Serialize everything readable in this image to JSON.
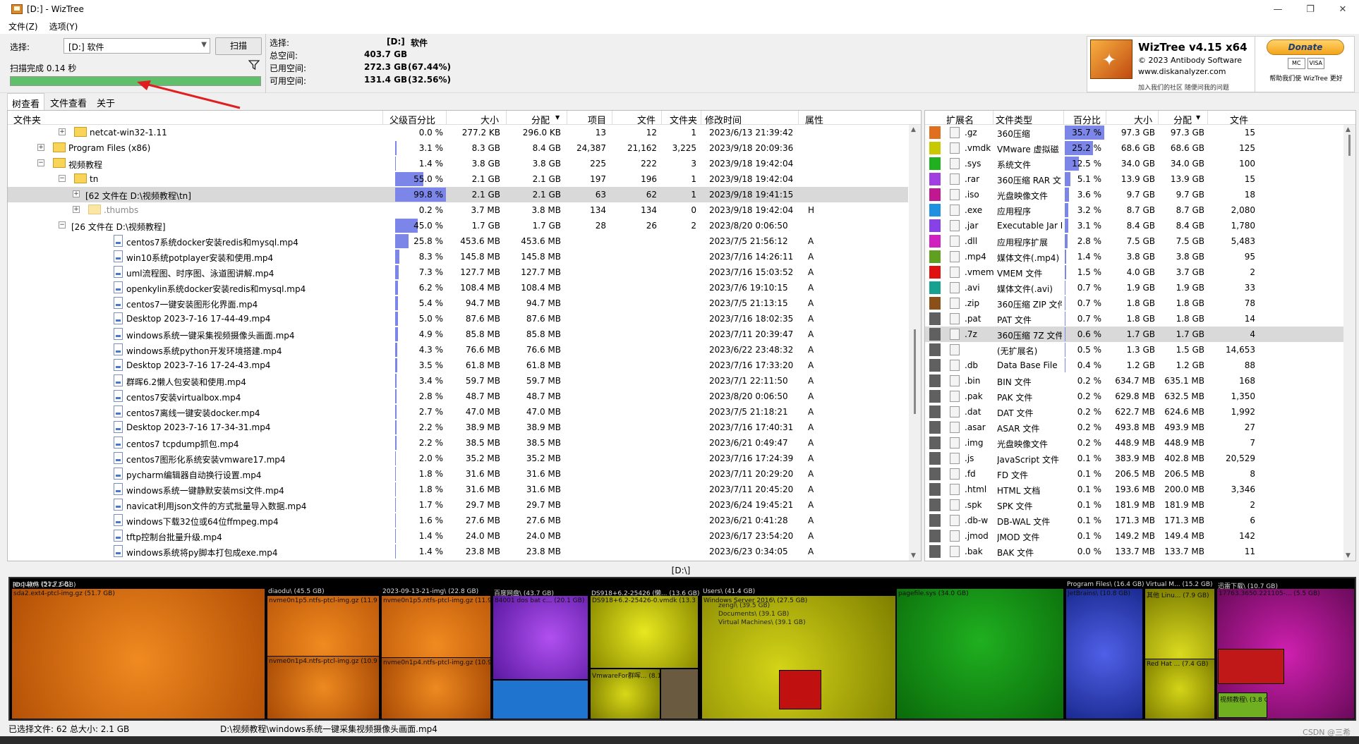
{
  "window": {
    "title": "[D:]  - WizTree"
  },
  "menu": {
    "file": "文件(Z)",
    "options": "选项(Y)"
  },
  "select": {
    "label": "选择:",
    "value": "[D:] 软件",
    "scan_button": "扫描",
    "scan_done": "扫描完成 0.14 秒",
    "progress": 1.0
  },
  "stats": {
    "select_label": "选择:",
    "drive": "[D:]",
    "drive_name": "软件",
    "total_label": "总空间:",
    "total": "403.7 GB",
    "used_label": "已用空间:",
    "used": "272.3 GB",
    "used_pct": "(67.44%)",
    "free_label": "可用空间:",
    "free": "131.4 GB",
    "free_pct": "(32.56%)"
  },
  "brand": {
    "name": "WizTree v4.15 x64",
    "copyright": "© 2023 Antibody Software",
    "url": "www.diskanalyzer.com",
    "sub": "加入我们的社区 随便问我的问题"
  },
  "donate": {
    "label": "Donate",
    "card1": "MC",
    "card2": "VISA",
    "thanks": "帮助我们使 WizTree 更好"
  },
  "tabs": [
    "树查看",
    "文件查看",
    "关于"
  ],
  "tree": {
    "headers": [
      "文件夹",
      "父级百分比",
      "大小",
      "分配",
      "项目",
      "文件",
      "文件夹",
      "修改时间",
      "属性"
    ],
    "rows": [
      {
        "name": "netcat-win32-1.11",
        "indent": 2,
        "type": "folder",
        "exp": "+",
        "pct": "0.0 %",
        "pctv": 0.0,
        "size": "277.2 KB",
        "alloc": "296.0 KB",
        "items": "13",
        "files": "12",
        "folders": "1",
        "mtime": "2023/6/13 21:39:42",
        "attr": ""
      },
      {
        "name": "Program Files (x86)",
        "indent": 1,
        "type": "folder",
        "exp": "+",
        "pct": "3.1 %",
        "pctv": 0.031,
        "size": "8.3 GB",
        "alloc": "8.4 GB",
        "items": "24,387",
        "files": "21,162",
        "folders": "3,225",
        "mtime": "2023/9/18 20:09:36",
        "attr": ""
      },
      {
        "name": "视频教程",
        "indent": 1,
        "type": "folder",
        "exp": "−",
        "pct": "1.4 %",
        "pctv": 0.014,
        "size": "3.8 GB",
        "alloc": "3.8 GB",
        "items": "225",
        "files": "222",
        "folders": "3",
        "mtime": "2023/9/18 19:42:04",
        "attr": ""
      },
      {
        "name": "tn",
        "indent": 2,
        "type": "folder",
        "exp": "−",
        "pct": "55.0 %",
        "pctv": 0.55,
        "size": "2.1 GB",
        "alloc": "2.1 GB",
        "items": "197",
        "files": "196",
        "folders": "1",
        "mtime": "2023/9/18 19:42:04",
        "attr": ""
      },
      {
        "name": "[62 文件在 D:\\视频教程\\tn]",
        "indent": 3,
        "type": "none",
        "exp": "+",
        "pct": "99.8 %",
        "pctv": 0.998,
        "size": "2.1 GB",
        "alloc": "2.1 GB",
        "items": "63",
        "files": "62",
        "folders": "1",
        "mtime": "2023/9/18 19:41:15",
        "attr": "",
        "hl": true
      },
      {
        "name": ".thumbs",
        "indent": 3,
        "type": "folder",
        "exp": "+",
        "pct": "0.2 %",
        "pctv": 0.002,
        "size": "3.7 MB",
        "alloc": "3.8 MB",
        "items": "134",
        "files": "134",
        "folders": "0",
        "mtime": "2023/9/18 19:42:04",
        "attr": "H",
        "dim": true
      },
      {
        "name": "[26 文件在 D:\\视频教程]",
        "indent": 2,
        "type": "none",
        "exp": "−",
        "pct": "45.0 %",
        "pctv": 0.45,
        "size": "1.7 GB",
        "alloc": "1.7 GB",
        "items": "28",
        "files": "26",
        "folders": "2",
        "mtime": "2023/8/20 0:06:50",
        "attr": ""
      },
      {
        "name": "centos7系统docker安装redis和mysql.mp4",
        "indent": 4,
        "type": "file",
        "pct": "25.8 %",
        "pctv": 0.258,
        "size": "453.6 MB",
        "alloc": "453.6 MB",
        "items": "",
        "files": "",
        "folders": "",
        "mtime": "2023/7/5 21:56:12",
        "attr": "A"
      },
      {
        "name": "win10系统potplayer安装和使用.mp4",
        "indent": 4,
        "type": "file",
        "pct": "8.3 %",
        "pctv": 0.083,
        "size": "145.8 MB",
        "alloc": "145.8 MB",
        "items": "",
        "files": "",
        "folders": "",
        "mtime": "2023/7/16 14:26:11",
        "attr": "A"
      },
      {
        "name": "uml流程图、时序图、泳道图讲解.mp4",
        "indent": 4,
        "type": "file",
        "pct": "7.3 %",
        "pctv": 0.073,
        "size": "127.7 MB",
        "alloc": "127.7 MB",
        "items": "",
        "files": "",
        "folders": "",
        "mtime": "2023/7/16 15:03:52",
        "attr": "A"
      },
      {
        "name": "openkylin系统docker安装redis和mysql.mp4",
        "indent": 4,
        "type": "file",
        "pct": "6.2 %",
        "pctv": 0.062,
        "size": "108.4 MB",
        "alloc": "108.4 MB",
        "items": "",
        "files": "",
        "folders": "",
        "mtime": "2023/7/6 19:10:15",
        "attr": "A"
      },
      {
        "name": "centos7一键安装图形化界面.mp4",
        "indent": 4,
        "type": "file",
        "pct": "5.4 %",
        "pctv": 0.054,
        "size": "94.7 MB",
        "alloc": "94.7 MB",
        "items": "",
        "files": "",
        "folders": "",
        "mtime": "2023/7/5 21:13:15",
        "attr": "A"
      },
      {
        "name": "Desktop 2023-7-16 17-44-49.mp4",
        "indent": 4,
        "type": "file",
        "pct": "5.0 %",
        "pctv": 0.05,
        "size": "87.6 MB",
        "alloc": "87.6 MB",
        "items": "",
        "files": "",
        "folders": "",
        "mtime": "2023/7/16 18:02:35",
        "attr": "A"
      },
      {
        "name": "windows系统一键采集视频摄像头画面.mp4",
        "indent": 4,
        "type": "file",
        "pct": "4.9 %",
        "pctv": 0.049,
        "size": "85.8 MB",
        "alloc": "85.8 MB",
        "items": "",
        "files": "",
        "folders": "",
        "mtime": "2023/7/11 20:39:47",
        "attr": "A"
      },
      {
        "name": "windows系统python开发环境搭建.mp4",
        "indent": 4,
        "type": "file",
        "pct": "4.3 %",
        "pctv": 0.043,
        "size": "76.6 MB",
        "alloc": "76.6 MB",
        "items": "",
        "files": "",
        "folders": "",
        "mtime": "2023/6/22 23:48:32",
        "attr": "A"
      },
      {
        "name": "Desktop 2023-7-16 17-24-43.mp4",
        "indent": 4,
        "type": "file",
        "pct": "3.5 %",
        "pctv": 0.035,
        "size": "61.8 MB",
        "alloc": "61.8 MB",
        "items": "",
        "files": "",
        "folders": "",
        "mtime": "2023/7/16 17:33:20",
        "attr": "A"
      },
      {
        "name": "群晖6.2懒人包安装和使用.mp4",
        "indent": 4,
        "type": "file",
        "pct": "3.4 %",
        "pctv": 0.034,
        "size": "59.7 MB",
        "alloc": "59.7 MB",
        "items": "",
        "files": "",
        "folders": "",
        "mtime": "2023/7/1 22:11:50",
        "attr": "A"
      },
      {
        "name": "centos7安装virtualbox.mp4",
        "indent": 4,
        "type": "file",
        "pct": "2.8 %",
        "pctv": 0.028,
        "size": "48.7 MB",
        "alloc": "48.7 MB",
        "items": "",
        "files": "",
        "folders": "",
        "mtime": "2023/8/20 0:06:50",
        "attr": "A"
      },
      {
        "name": "centos7离线一键安装docker.mp4",
        "indent": 4,
        "type": "file",
        "pct": "2.7 %",
        "pctv": 0.027,
        "size": "47.0 MB",
        "alloc": "47.0 MB",
        "items": "",
        "files": "",
        "folders": "",
        "mtime": "2023/7/5 21:18:21",
        "attr": "A"
      },
      {
        "name": "Desktop 2023-7-16 17-34-31.mp4",
        "indent": 4,
        "type": "file",
        "pct": "2.2 %",
        "pctv": 0.022,
        "size": "38.9 MB",
        "alloc": "38.9 MB",
        "items": "",
        "files": "",
        "folders": "",
        "mtime": "2023/7/16 17:40:31",
        "attr": "A"
      },
      {
        "name": "centos7 tcpdump抓包.mp4",
        "indent": 4,
        "type": "file",
        "pct": "2.2 %",
        "pctv": 0.022,
        "size": "38.5 MB",
        "alloc": "38.5 MB",
        "items": "",
        "files": "",
        "folders": "",
        "mtime": "2023/6/21 0:49:47",
        "attr": "A"
      },
      {
        "name": "centos7图形化系统安装vmware17.mp4",
        "indent": 4,
        "type": "file",
        "pct": "2.0 %",
        "pctv": 0.02,
        "size": "35.2 MB",
        "alloc": "35.2 MB",
        "items": "",
        "files": "",
        "folders": "",
        "mtime": "2023/7/16 17:24:39",
        "attr": "A"
      },
      {
        "name": "pycharm编辑器自动换行设置.mp4",
        "indent": 4,
        "type": "file",
        "pct": "1.8 %",
        "pctv": 0.018,
        "size": "31.6 MB",
        "alloc": "31.6 MB",
        "items": "",
        "files": "",
        "folders": "",
        "mtime": "2023/7/11 20:29:20",
        "attr": "A"
      },
      {
        "name": "windows系统一键静默安装msi文件.mp4",
        "indent": 4,
        "type": "file",
        "pct": "1.8 %",
        "pctv": 0.018,
        "size": "31.6 MB",
        "alloc": "31.6 MB",
        "items": "",
        "files": "",
        "folders": "",
        "mtime": "2023/7/11 20:45:20",
        "attr": "A"
      },
      {
        "name": "navicat利用json文件的方式批量导入数据.mp4",
        "indent": 4,
        "type": "file",
        "pct": "1.7 %",
        "pctv": 0.017,
        "size": "29.7 MB",
        "alloc": "29.7 MB",
        "items": "",
        "files": "",
        "folders": "",
        "mtime": "2023/6/24 19:45:21",
        "attr": "A"
      },
      {
        "name": "windows下载32位或64位ffmpeg.mp4",
        "indent": 4,
        "type": "file",
        "pct": "1.6 %",
        "pctv": 0.016,
        "size": "27.6 MB",
        "alloc": "27.6 MB",
        "items": "",
        "files": "",
        "folders": "",
        "mtime": "2023/6/21 0:41:28",
        "attr": "A"
      },
      {
        "name": "tftp控制台批量升级.mp4",
        "indent": 4,
        "type": "file",
        "pct": "1.4 %",
        "pctv": 0.014,
        "size": "24.0 MB",
        "alloc": "24.0 MB",
        "items": "",
        "files": "",
        "folders": "",
        "mtime": "2023/6/17 23:54:20",
        "attr": "A"
      },
      {
        "name": "windows系统将py脚本打包成exe.mp4",
        "indent": 4,
        "type": "file",
        "pct": "1.4 %",
        "pctv": 0.014,
        "size": "23.8 MB",
        "alloc": "23.8 MB",
        "items": "",
        "files": "",
        "folders": "",
        "mtime": "2023/6/23 0:34:05",
        "attr": "A"
      }
    ]
  },
  "ext": {
    "headers": [
      "扩展名",
      "文件类型",
      "百分比",
      "大小",
      "分配",
      "文件"
    ],
    "rows": [
      {
        "color": "#e07020",
        "ext": ".gz",
        "type": "360压缩",
        "pct": "35.7 %",
        "pctv": 0.357,
        "size": "97.3 GB",
        "alloc": "97.3 GB",
        "files": "15"
      },
      {
        "color": "#c8c800",
        "ext": ".vmdk",
        "type": "VMware 虚拟磁",
        "pct": "25.2 %",
        "pctv": 0.252,
        "size": "68.6 GB",
        "alloc": "68.6 GB",
        "files": "125"
      },
      {
        "color": "#20b020",
        "ext": ".sys",
        "type": "系统文件",
        "pct": "12.5 %",
        "pctv": 0.125,
        "size": "34.0 GB",
        "alloc": "34.0 GB",
        "files": "100"
      },
      {
        "color": "#a040e0",
        "ext": ".rar",
        "type": "360压缩 RAR 文",
        "pct": "5.1 %",
        "pctv": 0.051,
        "size": "13.9 GB",
        "alloc": "13.9 GB",
        "files": "15"
      },
      {
        "color": "#c01890",
        "ext": ".iso",
        "type": "光盘映像文件",
        "pct": "3.6 %",
        "pctv": 0.036,
        "size": "9.7 GB",
        "alloc": "9.7 GB",
        "files": "18"
      },
      {
        "color": "#2090e0",
        "ext": ".exe",
        "type": "应用程序",
        "pct": "3.2 %",
        "pctv": 0.032,
        "size": "8.7 GB",
        "alloc": "8.7 GB",
        "files": "2,080"
      },
      {
        "color": "#8840e8",
        "ext": ".jar",
        "type": "Executable Jar Fi",
        "pct": "3.1 %",
        "pctv": 0.031,
        "size": "8.4 GB",
        "alloc": "8.4 GB",
        "files": "1,780"
      },
      {
        "color": "#d020c0",
        "ext": ".dll",
        "type": "应用程序扩展",
        "pct": "2.8 %",
        "pctv": 0.028,
        "size": "7.5 GB",
        "alloc": "7.5 GB",
        "files": "5,483"
      },
      {
        "color": "#60a020",
        "ext": ".mp4",
        "type": "媒体文件(.mp4)",
        "pct": "1.4 %",
        "pctv": 0.014,
        "size": "3.8 GB",
        "alloc": "3.8 GB",
        "files": "95"
      },
      {
        "color": "#e01010",
        "ext": ".vmem",
        "type": "VMEM 文件",
        "pct": "1.5 %",
        "pctv": 0.015,
        "size": "4.0 GB",
        "alloc": "3.7 GB",
        "files": "2"
      },
      {
        "color": "#18a090",
        "ext": ".avi",
        "type": "媒体文件(.avi)",
        "pct": "0.7 %",
        "pctv": 0.007,
        "size": "1.9 GB",
        "alloc": "1.9 GB",
        "files": "33"
      },
      {
        "color": "#8a5018",
        "ext": ".zip",
        "type": "360压缩 ZIP 文件",
        "pct": "0.7 %",
        "pctv": 0.007,
        "size": "1.8 GB",
        "alloc": "1.8 GB",
        "files": "78"
      },
      {
        "color": "#606060",
        "ext": ".pat",
        "type": "PAT 文件",
        "pct": "0.7 %",
        "pctv": 0.007,
        "size": "1.8 GB",
        "alloc": "1.8 GB",
        "files": "14"
      },
      {
        "color": "#606060",
        "ext": ".7z",
        "type": "360压缩 7Z 文件",
        "pct": "0.6 %",
        "pctv": 0.006,
        "size": "1.7 GB",
        "alloc": "1.7 GB",
        "files": "4",
        "hl": true
      },
      {
        "color": "#606060",
        "ext": "",
        "type": "(无扩展名)",
        "pct": "0.5 %",
        "pctv": 0.005,
        "size": "1.3 GB",
        "alloc": "1.5 GB",
        "files": "14,653"
      },
      {
        "color": "#606060",
        "ext": ".db",
        "type": "Data Base File",
        "pct": "0.4 %",
        "pctv": 0.004,
        "size": "1.2 GB",
        "alloc": "1.2 GB",
        "files": "88"
      },
      {
        "color": "#606060",
        "ext": ".bin",
        "type": "BIN 文件",
        "pct": "0.2 %",
        "pctv": 0.002,
        "size": "634.7 MB",
        "alloc": "635.1 MB",
        "files": "168"
      },
      {
        "color": "#606060",
        "ext": ".pak",
        "type": "PAK 文件",
        "pct": "0.2 %",
        "pctv": 0.002,
        "size": "629.8 MB",
        "alloc": "632.5 MB",
        "files": "1,350"
      },
      {
        "color": "#606060",
        "ext": ".dat",
        "type": "DAT 文件",
        "pct": "0.2 %",
        "pctv": 0.002,
        "size": "622.7 MB",
        "alloc": "624.6 MB",
        "files": "1,992"
      },
      {
        "color": "#606060",
        "ext": ".asar",
        "type": "ASAR 文件",
        "pct": "0.2 %",
        "pctv": 0.002,
        "size": "493.8 MB",
        "alloc": "493.9 MB",
        "files": "27"
      },
      {
        "color": "#606060",
        "ext": ".img",
        "type": "光盘映像文件",
        "pct": "0.2 %",
        "pctv": 0.002,
        "size": "448.9 MB",
        "alloc": "448.9 MB",
        "files": "7"
      },
      {
        "color": "#606060",
        "ext": ".js",
        "type": "JavaScript 文件",
        "pct": "0.1 %",
        "pctv": 0.001,
        "size": "383.9 MB",
        "alloc": "402.8 MB",
        "files": "20,529"
      },
      {
        "color": "#606060",
        "ext": ".fd",
        "type": "FD 文件",
        "pct": "0.1 %",
        "pctv": 0.001,
        "size": "206.5 MB",
        "alloc": "206.5 MB",
        "files": "8"
      },
      {
        "color": "#606060",
        "ext": ".html",
        "type": "HTML 文档",
        "pct": "0.1 %",
        "pctv": 0.001,
        "size": "193.6 MB",
        "alloc": "200.0 MB",
        "files": "3,346"
      },
      {
        "color": "#606060",
        "ext": ".spk",
        "type": "SPK 文件",
        "pct": "0.1 %",
        "pctv": 0.001,
        "size": "181.9 MB",
        "alloc": "181.9 MB",
        "files": "2"
      },
      {
        "color": "#606060",
        "ext": ".db-w",
        "type": "DB-WAL 文件",
        "pct": "0.1 %",
        "pctv": 0.001,
        "size": "171.3 MB",
        "alloc": "171.3 MB",
        "files": "6"
      },
      {
        "color": "#606060",
        "ext": ".jmod",
        "type": "JMOD 文件",
        "pct": "0.1 %",
        "pctv": 0.001,
        "size": "149.2 MB",
        "alloc": "149.4 MB",
        "files": "142"
      },
      {
        "color": "#606060",
        "ext": ".bak",
        "type": "BAK 文件",
        "pct": "0.0 %",
        "pctv": 0.0,
        "size": "133.7 MB",
        "alloc": "133.7 MB",
        "files": "11"
      }
    ]
  },
  "path": "[D:\\]",
  "treemap": {
    "labels": {
      "root": "[D:] 软件 (272.2 GB)",
      "anquan": "anquan\\ (51.7 GB)",
      "sda2": "sda2.ext4-ptcl-img.gz (51.7 GB)",
      "diaodu": "diaodu\\ (45.5 GB)",
      "nvme1": "nvme0n1p5.ntfs-ptcl-img.gz (11.9 GB)",
      "nvme2": "nvme0n1p4.ntfs-ptcl-img.gz (10.9 GB)",
      "img2023": "2023-09-13-21-img\\ (22.8 GB)",
      "nvme3": "nvme0n1p5.ntfs-ptcl-img.gz (11.9 GB)",
      "nvme4": "nvme0n1p4.ntfs-ptcl-img.gz (10.9 GB)",
      "baidu": "百度网盘\\ (43.7 GB)",
      "dos": "84001 dos bat c... (20.1 GB)",
      "ds918": "DS918+6.2-25426 (懒... (13.6 GB)",
      "ds918v": "DS918+6.2-25426-0.vmdk (13.3 GB)",
      "vmfor": "VmwareFor群晖... (8.1 GB)",
      "users": "Users\\ (41.4 GB)",
      "zengl": "zengl\\ (39.5 GB)",
      "docs": "Documents\\ (39.1 GB)",
      "vm": "Virtual Machines\\ (39.1 GB)",
      "ws": "Windows Server 2016\\ (27.5 GB)",
      "pagefile": "pagefile.sys (34.0 GB)",
      "pf": "Program Files\\ (16.4 GB)",
      "jb": "JetBrains\\ (10.8 GB)",
      "vmm": "Virtual M... (15.2 GB)",
      "other": "其他 Linu... (7.9 GB)",
      "redhat": "Red Hat ... (7.4 GB)",
      "xunlei": "迅雷下载\\ (10.7 GB)",
      "xunlei2": "17763.3650.221105-... (5.5 GB)",
      "video": "视频教程\\ (3.8 GB)"
    }
  },
  "status": {
    "selected": "已选择文件: 62  总大小: 2.1 GB",
    "path": "D:\\视频教程\\windows系统一键采集视频摄像头画面.mp4"
  },
  "watermark": "CSDN @三希"
}
